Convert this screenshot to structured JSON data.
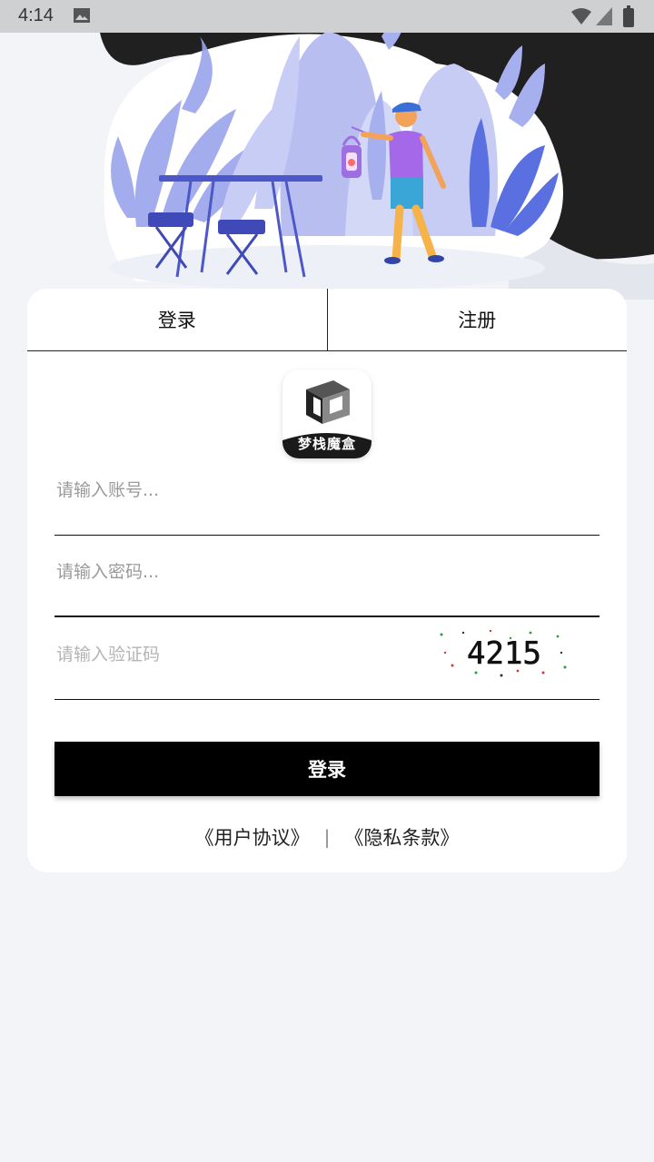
{
  "status_bar": {
    "time": "4:14"
  },
  "tabs": {
    "login": "登录",
    "register": "注册"
  },
  "logo": {
    "text": "梦栈魔盒"
  },
  "form": {
    "account_placeholder": "请输入账号...",
    "password_placeholder": "请输入密码...",
    "captcha_placeholder": "请输入验证码",
    "captcha_code": "4215",
    "submit_label": "登录"
  },
  "links": {
    "user_agreement": "《用户协议》",
    "separator": "|",
    "privacy_policy": "《隐私条款》"
  },
  "colors": {
    "page_background": "#f2f4f8",
    "accent": "#000000",
    "illustration_blue": "#7b86e0"
  }
}
